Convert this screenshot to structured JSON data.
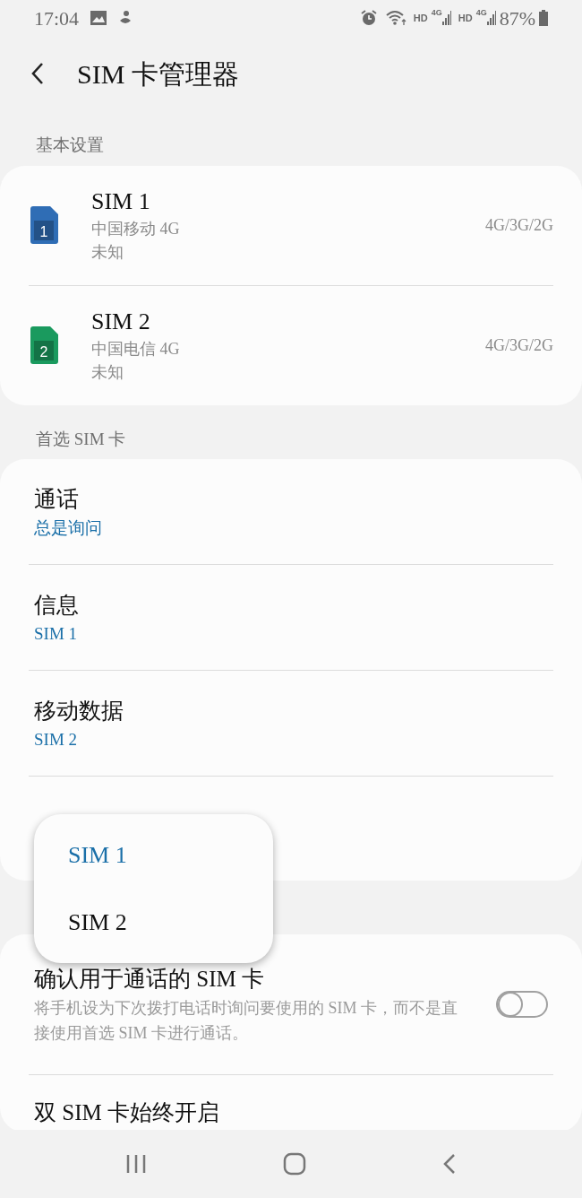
{
  "status_bar": {
    "time": "17:04",
    "network_1": "HD",
    "network_1_type": "4G",
    "network_2": "HD",
    "network_2_type": "4G",
    "battery": "87%"
  },
  "header": {
    "title": "SIM 卡管理器"
  },
  "sections": [
    {
      "kind": "sims",
      "title": "基本设置",
      "items": [
        {
          "name": "SIM 1",
          "badge": "1",
          "color": "#2f6db5",
          "carrier": "中国移动 4G",
          "status": "未知",
          "mode": "4G/3G/2G"
        },
        {
          "name": "SIM 2",
          "badge": "2",
          "color": "#1a9a5e",
          "carrier": "中国电信 4G",
          "status": "未知",
          "mode": "4G/3G/2G"
        }
      ]
    },
    {
      "kind": "prefs",
      "title": "首选 SIM 卡",
      "items": [
        {
          "label": "通话",
          "value": "总是询问"
        },
        {
          "label": "信息",
          "value": "SIM 1"
        },
        {
          "label": "移动数据",
          "value": "SIM 2"
        }
      ]
    },
    {
      "kind": "switches",
      "items": [
        {
          "label": "确认用于通话的 SIM 卡",
          "description": "将手机设为下次拨打电话时询问要使用的 SIM 卡，而不是直接使用首选 SIM 卡进行通话。",
          "on": false
        },
        {
          "label": "双 SIM 卡始终开启"
        }
      ]
    }
  ],
  "popup": {
    "options": [
      {
        "label": "SIM 1",
        "selected": true
      },
      {
        "label": "SIM 2",
        "selected": false
      }
    ]
  }
}
